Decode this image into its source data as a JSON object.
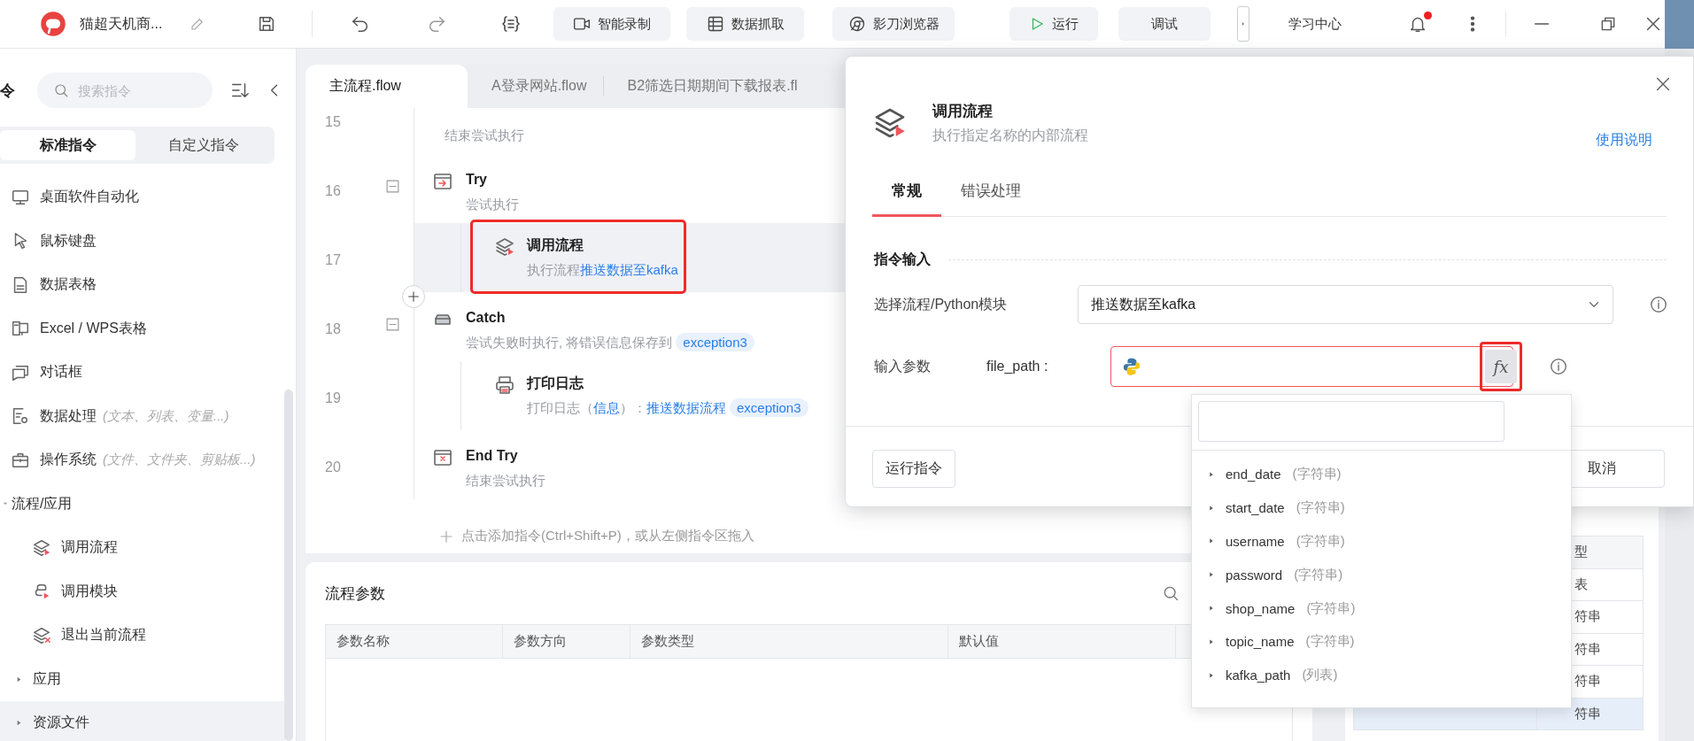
{
  "app_bar": {
    "title": "猫超天机商...",
    "tools": [
      {
        "label": "智能录制",
        "kind": "record"
      },
      {
        "label": "数据抓取",
        "kind": "grab"
      },
      {
        "label": "影刀浏览器",
        "kind": "browser"
      }
    ],
    "actions": [
      {
        "label": "运行",
        "kind": "run"
      },
      {
        "label": "调试",
        "kind": "debug"
      }
    ],
    "learn_link": "学习中心",
    "unread": true
  },
  "sidebar": {
    "title": "令",
    "search": {
      "placeholder": "搜索指令"
    },
    "segments": [
      {
        "label": "标准指令",
        "selected": true
      },
      {
        "label": "自定义指令",
        "selected": false
      }
    ],
    "items": [
      {
        "label": "桌面软件自动化",
        "kind": "desktop",
        "selected": false
      },
      {
        "label": "鼠标键盘",
        "kind": "mouse",
        "selected": false
      },
      {
        "label": "数据表格",
        "kind": "sheet",
        "selected": false
      },
      {
        "label": "Excel / WPS表格",
        "kind": "excel",
        "selected": false
      },
      {
        "label": "对话框",
        "kind": "dialog",
        "selected": false
      },
      {
        "label": "数据处理",
        "hint": "(文本、列表、变量...)",
        "kind": "data",
        "selected": false
      },
      {
        "label": "操作系统",
        "hint": "(文件、文件夹、剪贴板...)",
        "kind": "system",
        "selected": false
      },
      {
        "label": "流程/应用",
        "kind": "flow",
        "expanded": true,
        "selected": false,
        "children": [
          {
            "label": "调用流程",
            "kind": "call",
            "selected": false
          },
          {
            "label": "调用模块",
            "kind": "module",
            "selected": false
          },
          {
            "label": "退出当前流程",
            "kind": "exit",
            "selected": false
          }
        ]
      },
      {
        "label": "应用",
        "kind": "folder",
        "expanded": false,
        "selected": false
      },
      {
        "label": "资源文件",
        "kind": "folder",
        "expanded": false,
        "selected": true
      }
    ]
  },
  "editor": {
    "tabs": [
      {
        "label": "主流程.flow",
        "selected": true
      },
      {
        "label": "A登录网站.flow",
        "selected": false
      },
      {
        "label": "B2筛选日期期间下载报表.fl",
        "selected": false
      }
    ],
    "steps": [
      {
        "line": "15",
        "kind": "end",
        "selected": false,
        "desc": [
          {
            "kind": "text",
            "text": "结束尝试执行"
          }
        ]
      },
      {
        "line": "16",
        "kind": "try",
        "title": "Try",
        "expanded": true,
        "selected": false,
        "desc": [
          {
            "kind": "text",
            "text": "尝试执行"
          }
        ],
        "children": [
          {
            "line": "17",
            "kind": "call",
            "title": "调用流程",
            "selected": true,
            "marked": true,
            "desc": [
              {
                "kind": "text",
                "text": "执行流程"
              },
              {
                "kind": "link",
                "text": "推送数据至kafka"
              }
            ]
          }
        ]
      },
      {
        "line": "18",
        "kind": "catch",
        "title": "Catch",
        "expanded": true,
        "selected": false,
        "desc": [
          {
            "kind": "text",
            "text": "尝试失败时执行, 将错误信息保存到"
          },
          {
            "kind": "chip",
            "text": "exception3"
          }
        ],
        "children": [
          {
            "line": "19",
            "kind": "log",
            "title": "打印日志",
            "selected": false,
            "marked": false,
            "desc": [
              {
                "kind": "text",
                "text": "打印日志（"
              },
              {
                "kind": "link",
                "text": "信息"
              },
              {
                "kind": "text",
                "text": "）："
              },
              {
                "kind": "link",
                "text": "推送数据流程"
              },
              {
                "kind": "chip",
                "text": "exception3"
              }
            ]
          }
        ]
      },
      {
        "line": "20",
        "kind": "end",
        "title": "End Try",
        "selected": false,
        "desc": [
          {
            "kind": "text",
            "text": "结束尝试执行"
          }
        ]
      }
    ],
    "add_hint": "点击添加指令(Ctrl+Shift+P)，或从左侧指令区拖入"
  },
  "params": {
    "title": "流程参数",
    "columns": [
      "参数名称",
      "参数方向",
      "参数类型",
      "默认值"
    ]
  },
  "var_table": {
    "header": "型",
    "rows": [
      {
        "cell": "表",
        "selected": false
      },
      {
        "cell": "符串",
        "selected": false
      },
      {
        "cell": "符串",
        "selected": false
      },
      {
        "cell": "符串",
        "selected": false
      },
      {
        "cell": "符串",
        "selected": true
      }
    ]
  },
  "dialog": {
    "title": "调用流程",
    "subtitle": "执行指定名称的内部流程",
    "help": "使用说明",
    "tabs": [
      {
        "label": "常规",
        "selected": true
      },
      {
        "label": "错误处理",
        "selected": false
      }
    ],
    "section": "指令输入",
    "fields": [
      {
        "label": "选择流程/Python模块",
        "kind": "select",
        "value": "推送数据至kafka"
      },
      {
        "label": "输入参数",
        "kind": "param",
        "param": "file_path :",
        "focused": true,
        "fx": "fx",
        "marked": true
      }
    ],
    "buttons": [
      "运行指令",
      "取消"
    ]
  },
  "dropdown": {
    "items": [
      {
        "name": "end_date",
        "type": "(字符串)"
      },
      {
        "name": "start_date",
        "type": "(字符串)"
      },
      {
        "name": "username",
        "type": "(字符串)"
      },
      {
        "name": "password",
        "type": "(字符串)"
      },
      {
        "name": "shop_name",
        "type": "(字符串)"
      },
      {
        "name": "topic_name",
        "type": "(字符串)"
      },
      {
        "name": "kafka_path",
        "type": "(列表)"
      }
    ]
  }
}
